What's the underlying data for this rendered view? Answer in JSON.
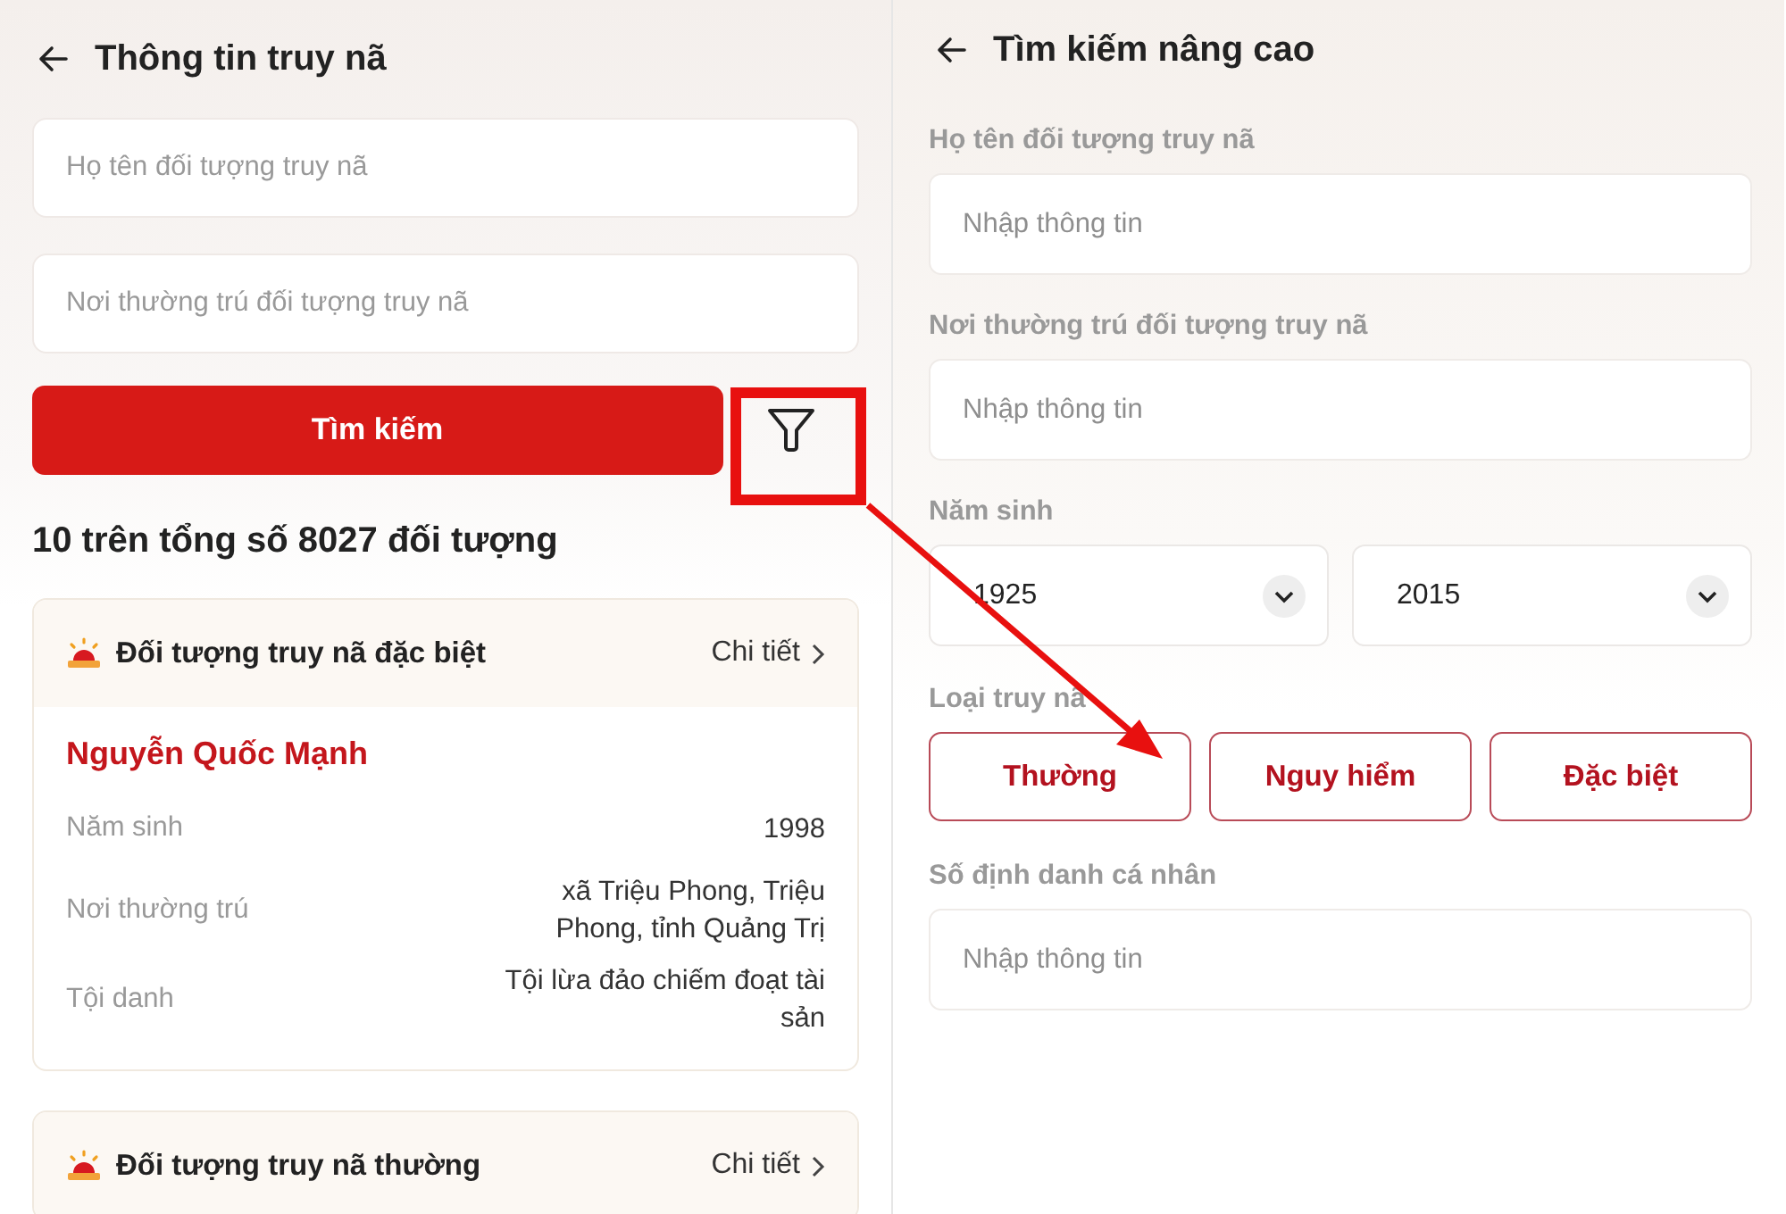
{
  "search_screen": {
    "title": "Thông tin truy nã",
    "fields": [
      {
        "placeholder": "Họ tên đối tượng truy nã"
      },
      {
        "placeholder": "Nơi thường trú đối tượng truy nã"
      }
    ],
    "search_button": "Tìm kiếm",
    "result_count": "10 trên tổng số 8027 đối tượng",
    "cards": [
      {
        "category": "Đối tượng truy nã đặc biệt",
        "detail_link": "Chi tiết",
        "name": "Nguyễn Quốc Mạnh",
        "rows": [
          {
            "label": "Năm sinh",
            "value": "1998"
          },
          {
            "label": "Nơi thường trú",
            "value": "xã Triệu Phong, Triệu Phong, tỉnh Quảng Trị"
          },
          {
            "label": "Tội danh",
            "value": "Tội lừa đảo chiếm đoạt tài sản"
          }
        ]
      },
      {
        "category": "Đối tượng truy nã thường",
        "detail_link": "Chi tiết"
      }
    ]
  },
  "advanced_screen": {
    "title": "Tìm kiếm nâng cao",
    "sections": [
      {
        "kind": "field",
        "label": "Họ tên đối tượng truy nã",
        "placeholder": "Nhập thông tin"
      },
      {
        "kind": "field",
        "label": "Nơi thường trú đối tượng truy nã",
        "placeholder": "Nhập thông tin"
      },
      {
        "kind": "selects",
        "label": "Năm sinh",
        "values": [
          "1925",
          "2015"
        ]
      },
      {
        "kind": "options",
        "label": "Loại truy nã",
        "options": [
          {
            "label": "Thường",
            "selected": false
          },
          {
            "label": "Nguy hiểm",
            "selected": false
          },
          {
            "label": "Đặc biệt",
            "selected": false
          }
        ]
      },
      {
        "kind": "field",
        "label": "Số định danh cá nhân",
        "placeholder": "Nhập thông tin"
      }
    ]
  }
}
